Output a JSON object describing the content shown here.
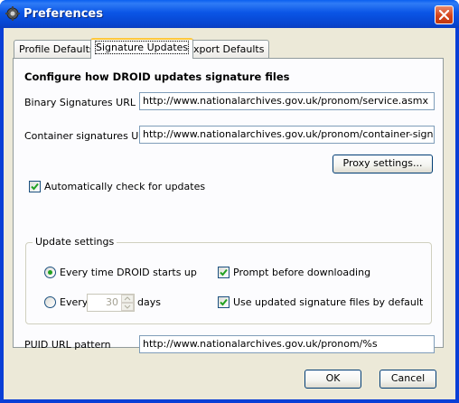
{
  "window": {
    "title": "Preferences",
    "app_icon": "gear-icon",
    "close_icon": "close-icon"
  },
  "tabs": [
    {
      "label": "Profile Defaults",
      "active": false
    },
    {
      "label": "Signature Updates",
      "active": true
    },
    {
      "label": "Export Defaults",
      "active": false
    }
  ],
  "panel": {
    "heading": "Configure how DROID updates signature files",
    "binary_url_label": "Binary Signatures URL",
    "binary_url_value": "http://www.nationalarchives.gov.uk/pronom/service.asmx",
    "container_url_label": "Container signatures URL",
    "container_url_value": "http://www.nationalarchives.gov.uk/pronom/container-signature.x",
    "proxy_button": "Proxy settings...",
    "auto_check_label": "Automatically check for updates",
    "auto_check_checked": true,
    "update_settings": {
      "title": "Update settings",
      "every_startup_label": "Every time DROID starts up",
      "every_startup_selected": true,
      "every_label": "Every",
      "every_days_value": "30",
      "days_label": "days",
      "prompt_label": "Prompt before downloading",
      "prompt_checked": true,
      "use_default_label": "Use updated signature files by default",
      "use_default_checked": true
    },
    "puid_label": "PUID URL pattern",
    "puid_value": "http://www.nationalarchives.gov.uk/pronom/%s"
  },
  "buttons": {
    "ok": "OK",
    "cancel": "Cancel"
  },
  "colors": {
    "title_bar": "#0a55e6",
    "dialog_bg": "#ece9d8",
    "panel_bg": "#fcfcfe",
    "check_green": "#21a121",
    "close_red": "#d5431a"
  }
}
